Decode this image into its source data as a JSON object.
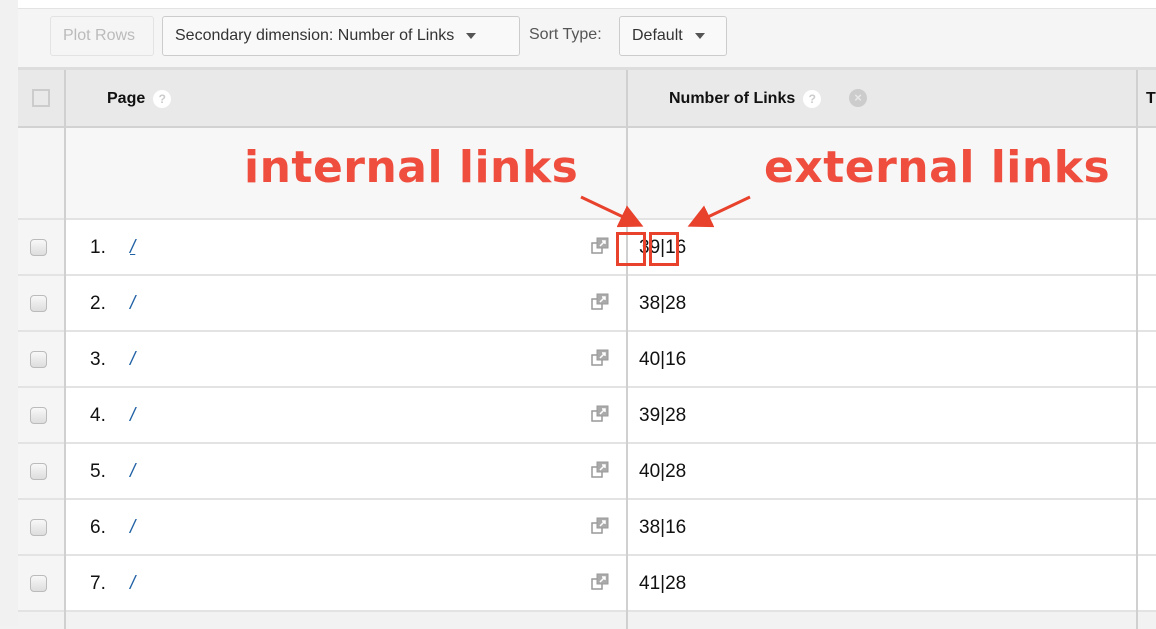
{
  "toolbar": {
    "plot_rows_label": "Plot Rows",
    "secondary_dimension_label": "Secondary dimension: Number of Links",
    "sort_type_label": "Sort Type:",
    "sort_type_value": "Default"
  },
  "table": {
    "columns": [
      {
        "label": "Page",
        "help_icon": "help-icon"
      },
      {
        "label": "Number of Links",
        "help_icon": "help-icon",
        "remove_icon": "close-circle-icon"
      },
      {
        "label": "T"
      }
    ],
    "rows": [
      {
        "index": "1.",
        "page": "/",
        "links": "39|16",
        "internal": "39",
        "external": "16"
      },
      {
        "index": "2.",
        "page": "/",
        "links": "38|28"
      },
      {
        "index": "3.",
        "page": "/",
        "links": "40|16"
      },
      {
        "index": "4.",
        "page": "/",
        "links": "39|28"
      },
      {
        "index": "5.",
        "page": "/",
        "links": "40|28"
      },
      {
        "index": "6.",
        "page": "/",
        "links": "38|16"
      },
      {
        "index": "7.",
        "page": "/",
        "links": "41|28"
      }
    ]
  },
  "annotations": {
    "internal_label": "internal links",
    "external_label": "external links",
    "color": "#ef4e3e"
  },
  "colors": {
    "link": "#2162a5",
    "header_bg": "#e9e9e9",
    "annotation": "#ef4e3e"
  }
}
